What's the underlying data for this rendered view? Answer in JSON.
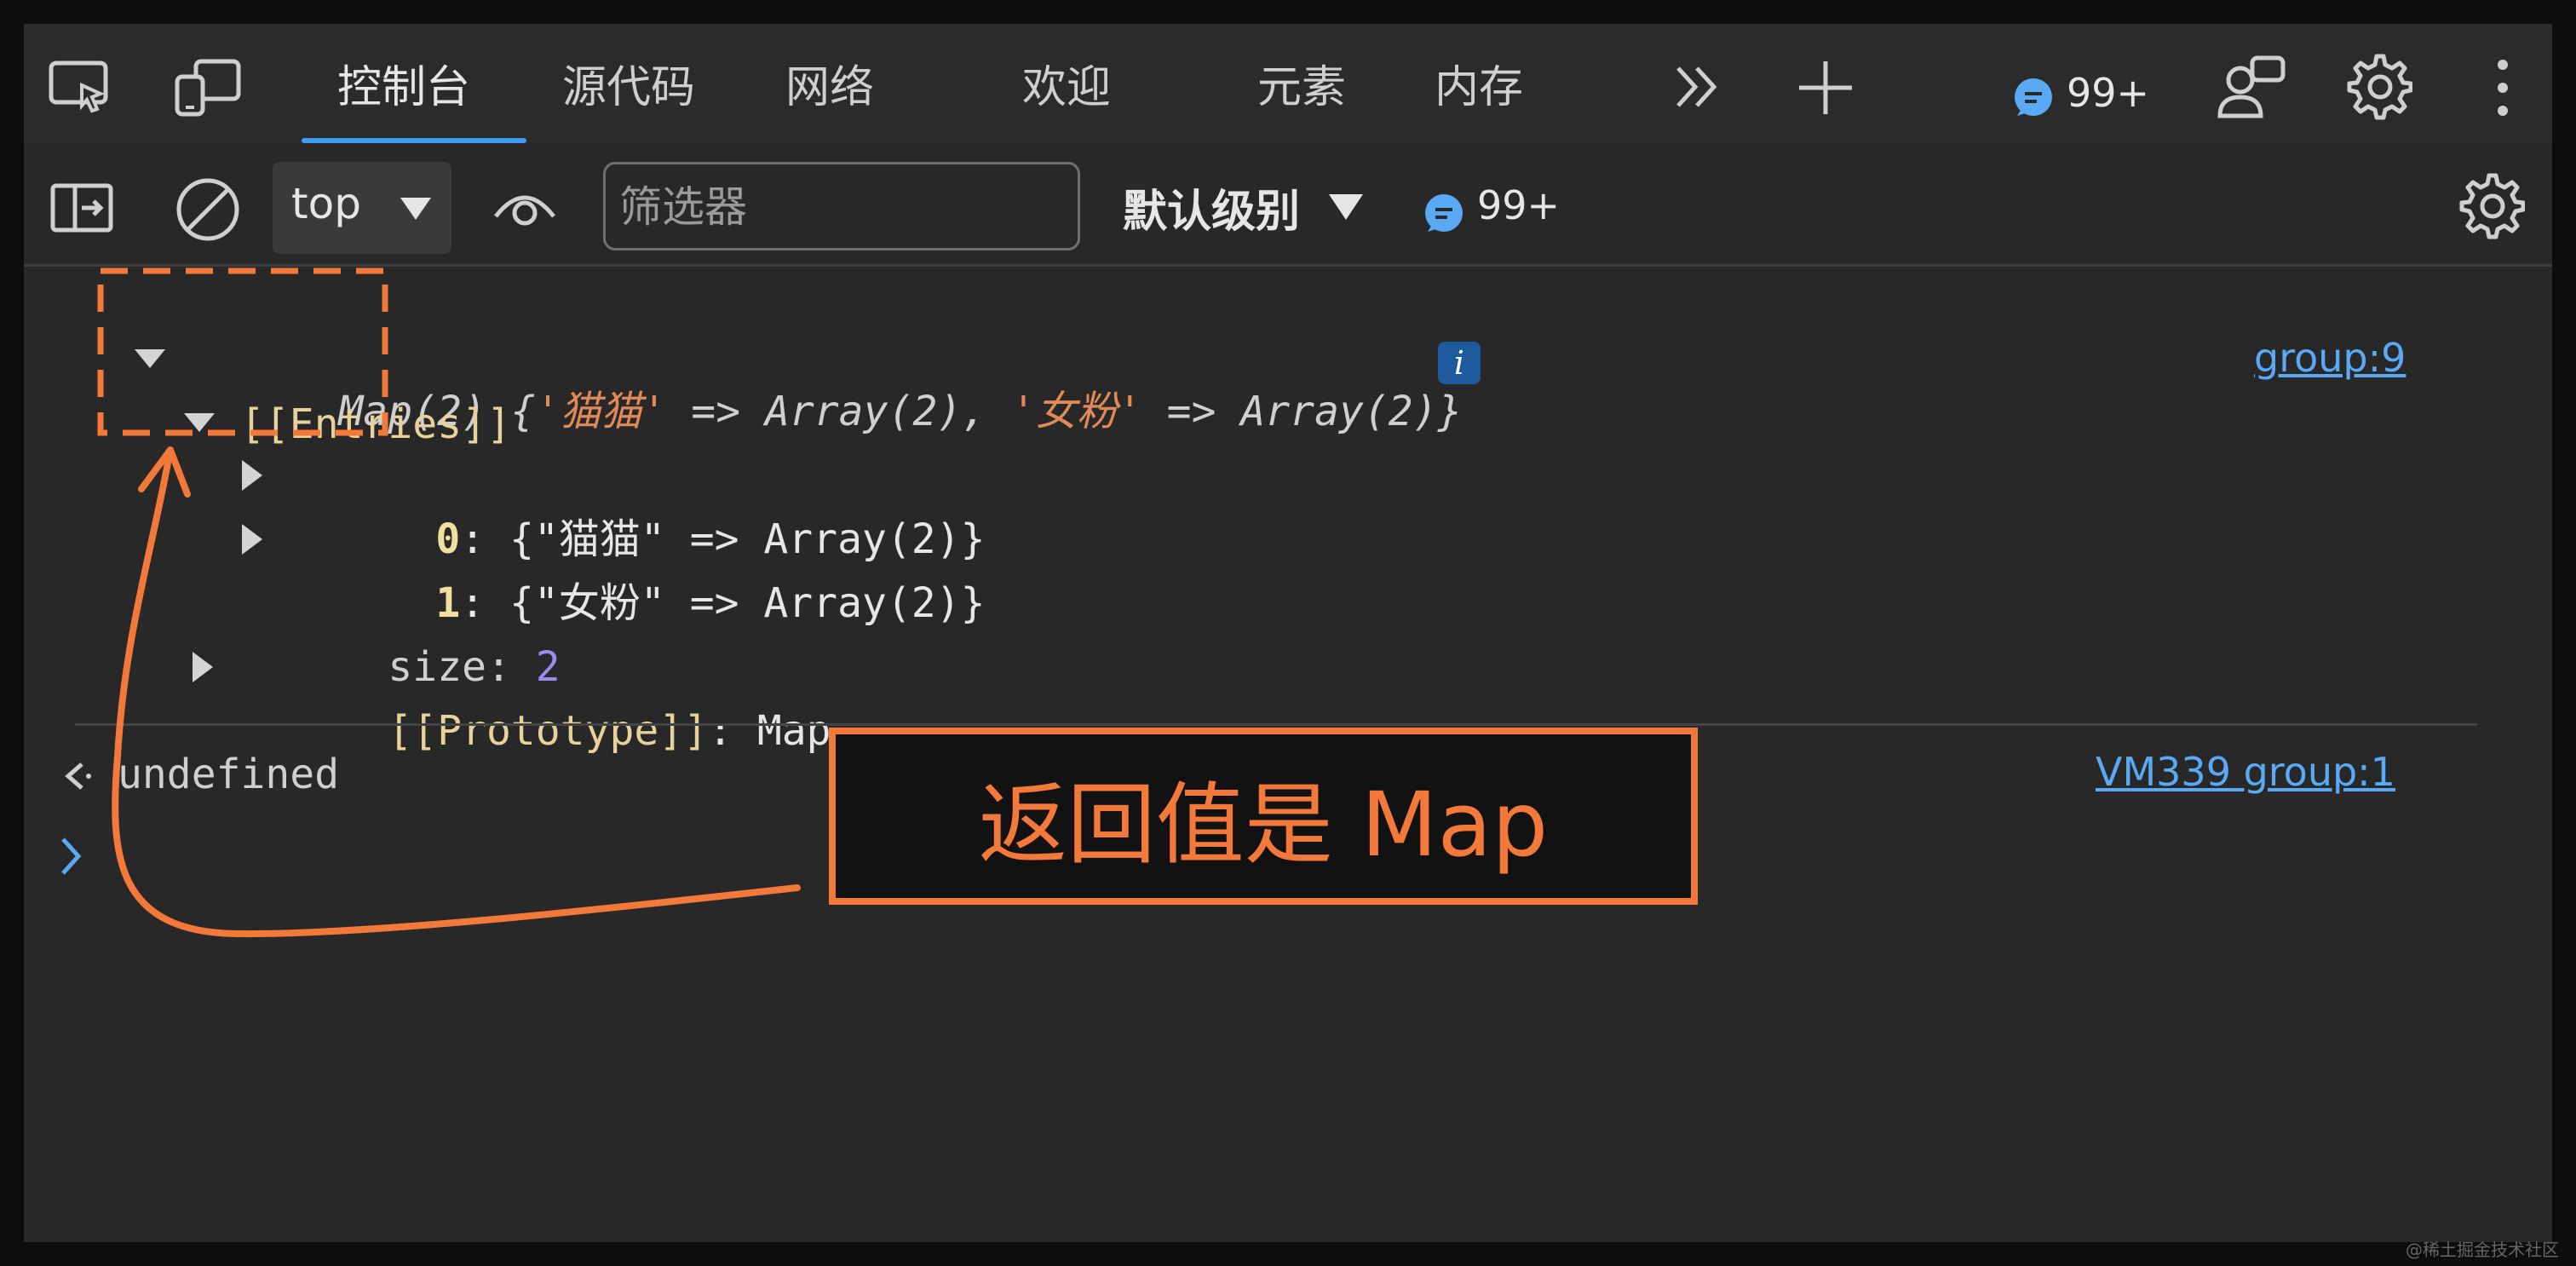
{
  "tabbar": {
    "tabs": [
      "控制台",
      "源代码",
      "网络",
      "欢迎",
      "元素",
      "内存"
    ],
    "message_count": "99+"
  },
  "toolbar": {
    "context": "top",
    "filter_placeholder": "筛选器",
    "level_label": "默认级别",
    "message_count": "99+"
  },
  "console": {
    "map_summary_prefix": "Map(2) {",
    "map_key1": "'猫猫'",
    "map_arrow1": " => Array(2), ",
    "map_key2": "'女粉'",
    "map_arrow2": " => Array(2)}",
    "info_badge": "i",
    "source_link_1": "group:9",
    "entries_label": "[[Entries]]",
    "entry0_index": "0",
    "entry0_value": ": {\"猫猫\" => Array(2)}",
    "entry1_index": "1",
    "entry1_value": ": {\"女粉\" => Array(2)}",
    "size_label": "size: ",
    "size_value": "2",
    "prototype_label": "[[Prototype]]",
    "prototype_value": ": Map",
    "result_text": "undefined",
    "source_link_2": "VM339 group:1"
  },
  "annotation": {
    "callout_text": "返回值是 Map",
    "color": "#f2793a"
  },
  "watermark": "@稀土掘金技术社区"
}
